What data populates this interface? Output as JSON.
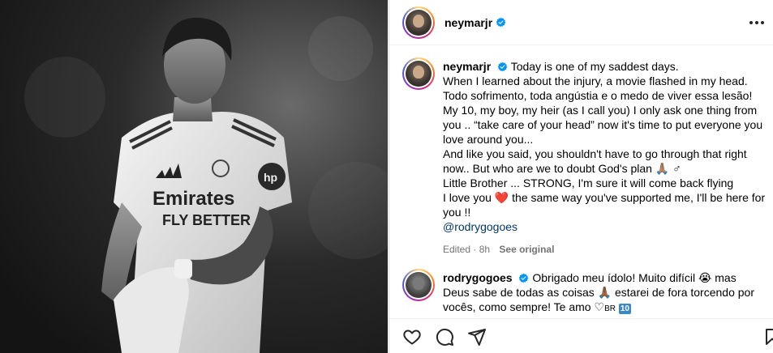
{
  "post": {
    "author": "neymarjr",
    "author_verified": true
  },
  "caption": {
    "username": "neymarjr",
    "lines": [
      "Today is one of my saddest days.",
      "When I learned about the injury, a movie flashed in my head.",
      "Todo sofrimento, toda angústia e o medo de viver essa lesão!",
      "My 10, my boy, my heir (as I call you) I only ask one thing from",
      "you .. “take care of your head” now it's time to put everyone you",
      "love around you...",
      "And like you said, you shouldn't have to go through that right",
      "now.. But who are we to doubt God's plan 🙏🏽 ♂",
      "Little Brother ... STRONG, I'm sure it will come back flying",
      "I love you",
      "the same way you've supported me, I'll be here for",
      "you !!"
    ],
    "mention": "@rodrygogoes",
    "edited_label": "Edited · 8h",
    "see_original_label": "See original"
  },
  "reply": {
    "username": "rodrygogoes",
    "text_part1": "Obrigado meu ídolo! Muito difícil 😭 mas",
    "text_part2": "Deus sabe de todas as coisas 🙏🏾 estarei de fora torcendo por",
    "text_part3": "vocês, como sempre! Te amo",
    "suffix": "BR",
    "suffix_num": "10"
  },
  "icons": {
    "like": "heart-icon",
    "comment": "comment-icon",
    "share": "share-icon",
    "save": "bookmark-icon",
    "more": "more-options-icon",
    "verified": "verified-badge-icon"
  },
  "colors": {
    "verified_blue": "#0095f6",
    "mention": "#00376b",
    "muted": "#737373",
    "heart": "#e0245e"
  }
}
